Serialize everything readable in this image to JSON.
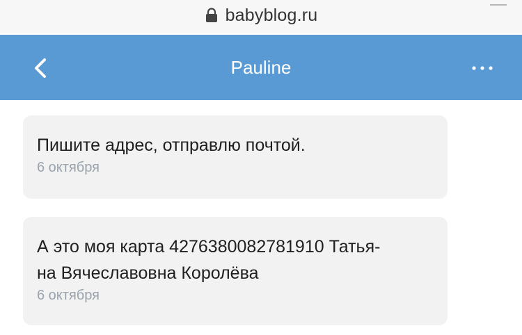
{
  "browser": {
    "url": "babyblog.ru",
    "lock_icon": "lock-icon"
  },
  "header": {
    "title": "Pauline",
    "background": "#5a9ad4",
    "back_icon": "chevron-left-icon",
    "more_icon": "more-dots-icon"
  },
  "messages": [
    {
      "text": "Пишите адрес, отправлю почтой.",
      "date": "6 октября"
    },
    {
      "text_line1": "А это моя карта 4276380082781910 Татья-",
      "text_line2": "на Вячеславовна Королёва",
      "date": "6 октября"
    }
  ]
}
